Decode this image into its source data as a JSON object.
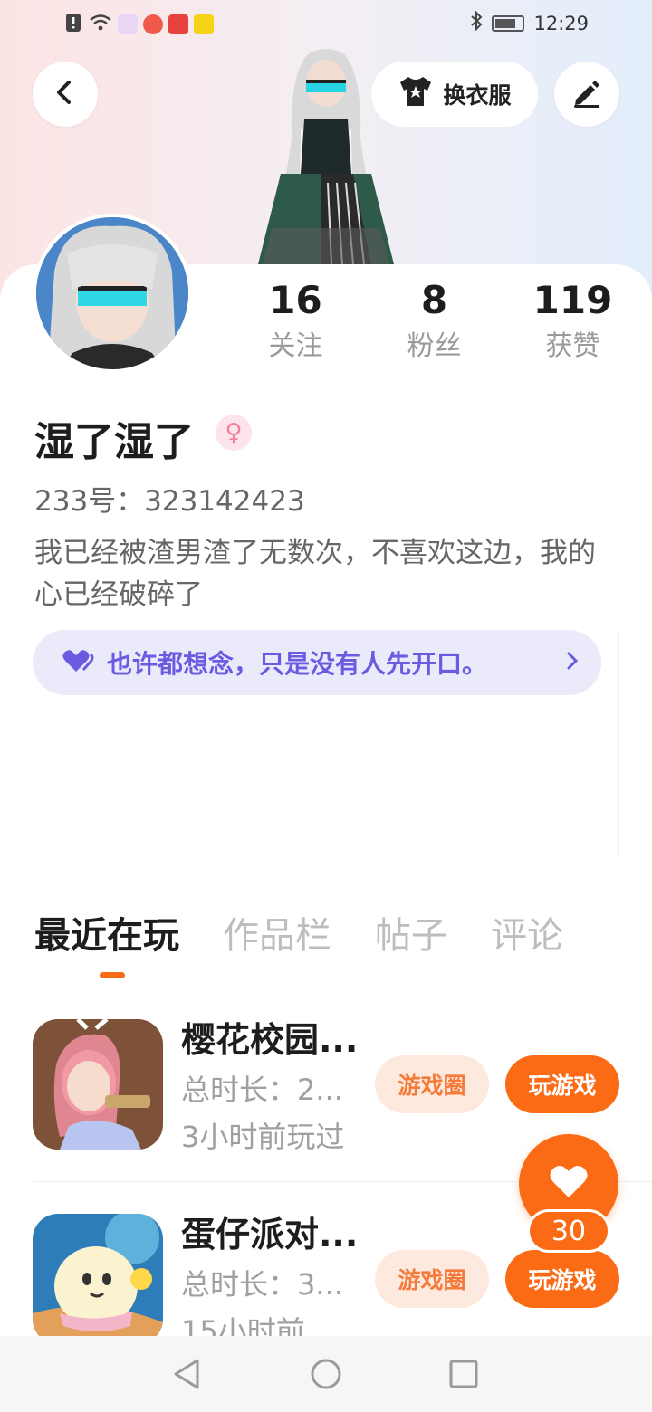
{
  "status_bar": {
    "time": "12:29",
    "icons": [
      "alert-icon",
      "wifi-icon",
      "app-icon-1",
      "app-icon-2",
      "app-icon-3",
      "app-icon-4",
      "bluetooth-icon",
      "battery-icon"
    ]
  },
  "header": {
    "outfit_label": "换衣服"
  },
  "profile": {
    "stats": [
      {
        "value": "16",
        "label": "关注"
      },
      {
        "value": "8",
        "label": "粉丝"
      },
      {
        "value": "119",
        "label": "获赞"
      }
    ],
    "username": "湿了湿了",
    "gender_symbol": "♀",
    "user_id": "233号：323142423",
    "bio": "我已经被渣男渣了无数次，不喜欢这边，我的心已经破碎了",
    "mood": "也许都想念，只是没有人先开口。"
  },
  "tabs": [
    {
      "label": "最近在玩",
      "active": true
    },
    {
      "label": "作品栏",
      "active": false
    },
    {
      "label": "帖子",
      "active": false
    },
    {
      "label": "评论",
      "active": false
    }
  ],
  "games": [
    {
      "name": "樱花校园...",
      "duration": "总时长：2...",
      "last_played": "3小时前玩过",
      "circle_label": "游戏圈",
      "play_label": "玩游戏"
    },
    {
      "name": "蛋仔派对...",
      "duration": "总时长：3...",
      "last_played": "15小时前",
      "circle_label": "游戏圈",
      "play_label": "玩游戏"
    }
  ],
  "like_fab": {
    "count": "30"
  },
  "colors": {
    "accent": "#fb6b16",
    "mood_text": "#6a5be1",
    "mood_bg": "#ebeafb"
  }
}
